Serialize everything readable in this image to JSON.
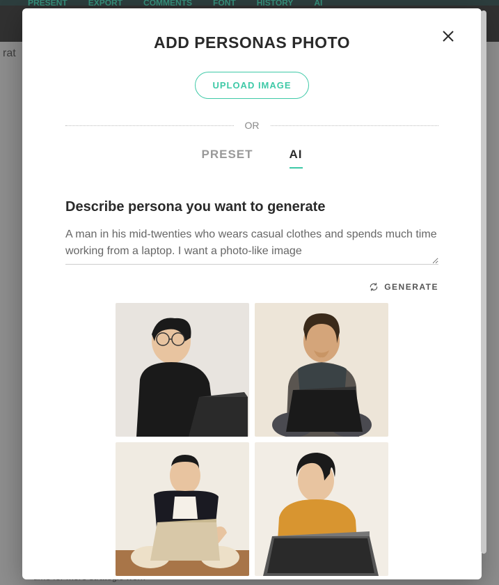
{
  "toolbar": {
    "items": [
      "PRESENT",
      "EXPORT",
      "COMMENTS",
      "FONT",
      "HISTORY",
      "AI"
    ]
  },
  "background": {
    "partial_left": "rat",
    "bottom_snippet": "time for more strategic work"
  },
  "modal": {
    "title": "ADD PERSONAS PHOTO",
    "upload_label": "UPLOAD IMAGE",
    "or_label": "OR",
    "tabs": {
      "preset": "PRESET",
      "ai": "AI"
    },
    "describe_label": "Describe persona you want to generate",
    "describe_value": "A man in his mid-twenties who wears casual clothes and spends much time working from a laptop. I want a photo-like image",
    "generate_label": "GENERATE",
    "thumbnails": [
      {
        "id": "persona-1"
      },
      {
        "id": "persona-2"
      },
      {
        "id": "persona-3"
      },
      {
        "id": "persona-4"
      }
    ]
  }
}
